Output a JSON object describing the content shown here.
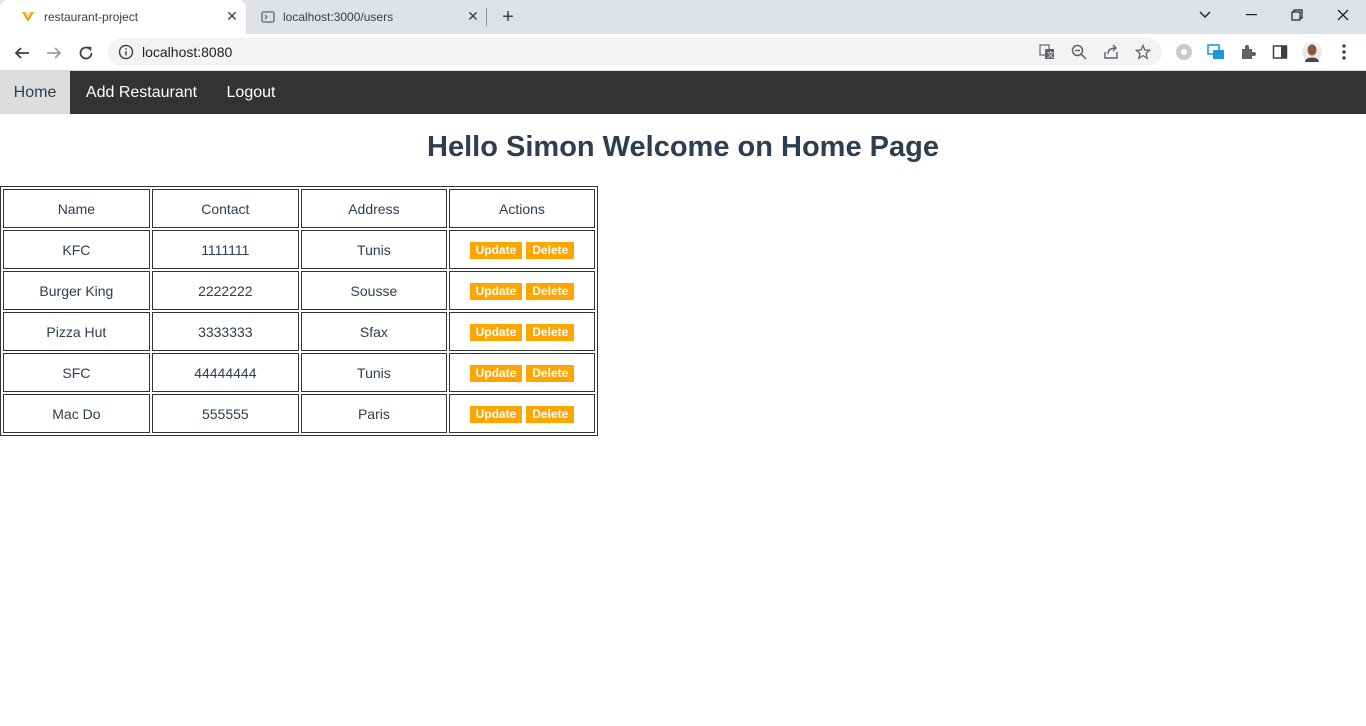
{
  "browser": {
    "tabs": [
      {
        "title": "restaurant-project",
        "active": true
      },
      {
        "title": "localhost:3000/users",
        "active": false
      }
    ],
    "url": "localhost:8080"
  },
  "nav": {
    "items": [
      {
        "label": "Home",
        "active": true
      },
      {
        "label": "Add Restaurant",
        "active": false
      },
      {
        "label": "Logout",
        "active": false
      }
    ]
  },
  "page": {
    "title": "Hello Simon Welcome on Home Page"
  },
  "table": {
    "headers": [
      "Name",
      "Contact",
      "Address",
      "Actions"
    ],
    "rows": [
      {
        "name": "KFC",
        "contact": "1111111",
        "address": "Tunis"
      },
      {
        "name": "Burger King",
        "contact": "2222222",
        "address": "Sousse"
      },
      {
        "name": "Pizza Hut",
        "contact": "3333333",
        "address": "Sfax"
      },
      {
        "name": "SFC",
        "contact": "44444444",
        "address": "Tunis"
      },
      {
        "name": "Mac Do",
        "contact": "555555",
        "address": "Paris"
      }
    ],
    "update_label": "Update",
    "delete_label": "Delete"
  },
  "colors": {
    "nav_bg": "#333333",
    "nav_active_bg": "#dddddd",
    "action_button": "#ffa500",
    "heading": "#2c3e50"
  }
}
